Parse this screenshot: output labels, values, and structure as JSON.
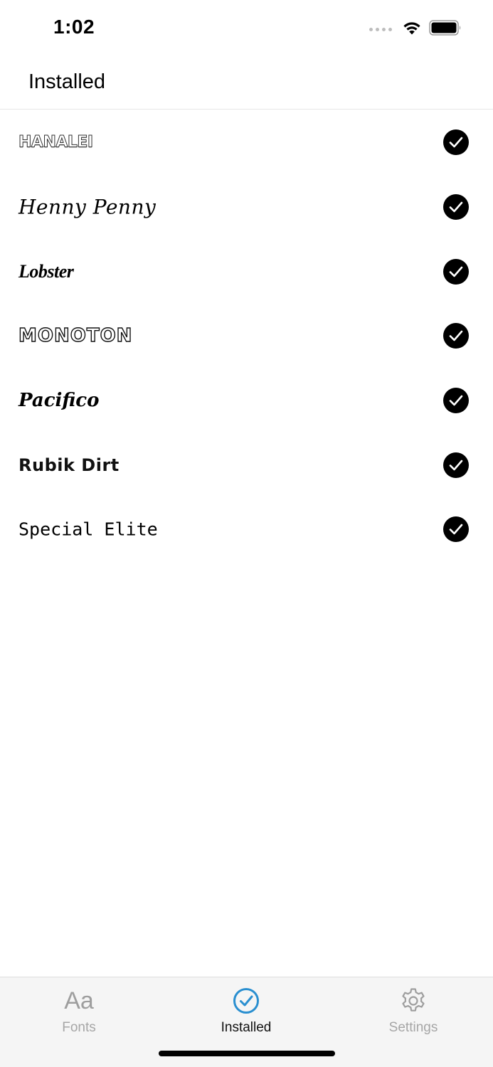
{
  "status_bar": {
    "time": "1:02"
  },
  "header": {
    "title": "Installed"
  },
  "fonts": [
    {
      "name": "HANALEI",
      "installed": true
    },
    {
      "name": "Henny Penny",
      "installed": true
    },
    {
      "name": "Lobster",
      "installed": true
    },
    {
      "name": "MONOTON",
      "installed": true
    },
    {
      "name": "Pacifico",
      "installed": true
    },
    {
      "name": "Rubik Dirt",
      "installed": true
    },
    {
      "name": "Special Elite",
      "installed": true
    }
  ],
  "tab_bar": {
    "tabs": [
      {
        "label": "Fonts",
        "icon": "Aa",
        "icon_name": "text-aa-icon",
        "selected": false
      },
      {
        "label": "Installed",
        "icon_name": "checkmark-circle-icon",
        "selected": true
      },
      {
        "label": "Settings",
        "icon_name": "gear-icon",
        "selected": false
      }
    ]
  },
  "colors": {
    "accent": "#2a8fd0",
    "inactive": "#a6a6a6",
    "tab_bar_bg": "#f5f5f5"
  }
}
